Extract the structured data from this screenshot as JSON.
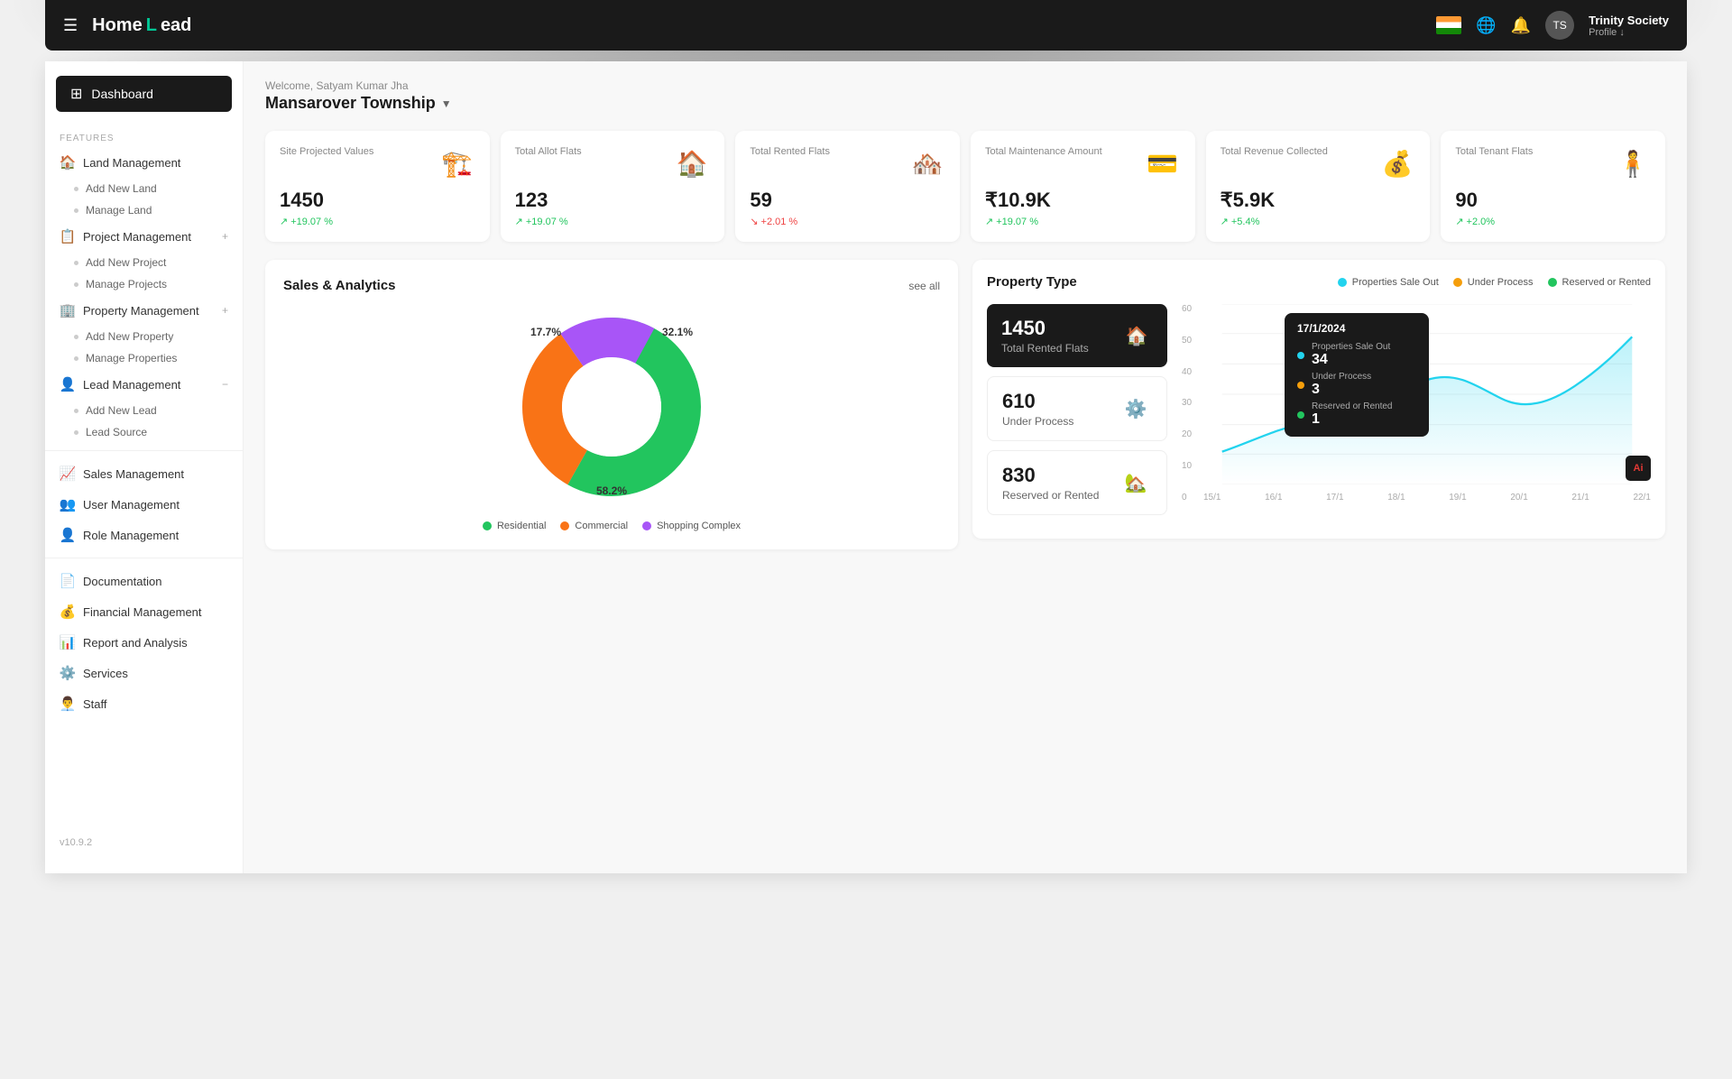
{
  "header": {
    "hamburger_label": "☰",
    "logo_text": "HomeLead",
    "user_name": "Trinity Society",
    "user_role": "Profile ↓",
    "avatar_initials": "TS"
  },
  "sidebar": {
    "dashboard_label": "Dashboard",
    "features_label": "FEATURES",
    "version": "v10.9.2",
    "nav_items": [
      {
        "label": "Land Management",
        "icon": "🏠",
        "expanded": true
      },
      {
        "label": "Add New Land",
        "sub": true
      },
      {
        "label": "Manage Land",
        "sub": true
      },
      {
        "label": "Project Management",
        "icon": "📋",
        "expanded": false
      },
      {
        "label": "Add New Project",
        "sub": true
      },
      {
        "label": "Manage Projects",
        "sub": true
      },
      {
        "label": "Property Management",
        "icon": "🏢",
        "expanded": true
      },
      {
        "label": "Add New Property",
        "sub": true
      },
      {
        "label": "Manage Properties",
        "sub": true
      },
      {
        "label": "Lead Management",
        "icon": "👤",
        "expanded": true
      },
      {
        "label": "Add New Lead",
        "sub": true
      },
      {
        "label": "Lead Source",
        "sub": true
      },
      {
        "label": "Sales Management",
        "icon": "📈"
      },
      {
        "label": "User Management",
        "icon": "👥"
      },
      {
        "label": "Role Management",
        "icon": "👤"
      },
      {
        "label": "Documentation",
        "icon": "📄"
      },
      {
        "label": "Financial Management",
        "icon": "💰"
      },
      {
        "label": "Report and Analysis",
        "icon": "📊"
      },
      {
        "label": "Services",
        "icon": "⚙️"
      },
      {
        "label": "Staff",
        "icon": "👨‍💼"
      }
    ]
  },
  "content": {
    "welcome_text": "Welcome, Satyam Kumar Jha",
    "society_name": "Mansarover Township",
    "stats": [
      {
        "label": "Site Projected Values",
        "value": "1450",
        "change": "+19.07 %",
        "positive": true
      },
      {
        "label": "Total Allot Flats",
        "value": "123",
        "change": "+19.07 %",
        "positive": true
      },
      {
        "label": "Total Rented Flats",
        "value": "59",
        "change": "+2.01 %",
        "positive": false
      },
      {
        "label": "Total Maintenance Amount",
        "value": "₹10.9K",
        "change": "+19.07 %",
        "positive": true
      },
      {
        "label": "Total Revenue Collected",
        "value": "₹5.9K",
        "change": "+5.4%",
        "positive": true
      },
      {
        "label": "Total Tenant Flats",
        "value": "90",
        "change": "+2.0%",
        "positive": true
      }
    ],
    "sales_analytics": {
      "title": "Sales & Analytics",
      "see_all": "see all",
      "segments": [
        {
          "label": "Residential",
          "value": 58.2,
          "color": "#22c55e"
        },
        {
          "label": "Commercial",
          "value": 32.1,
          "color": "#f97316"
        },
        {
          "label": "Shopping Complex",
          "value": 17.7,
          "color": "#a855f7"
        }
      ],
      "labels": [
        "17.7%",
        "32.1%",
        "58.2%"
      ]
    },
    "property_type": {
      "title": "Property Type",
      "legend": [
        {
          "label": "Properties Sale Out",
          "color": "#22d3ee"
        },
        {
          "label": "Under Process",
          "color": "#f59e0b"
        },
        {
          "label": "Reserved or Rented",
          "color": "#22c55e"
        }
      ],
      "cards": [
        {
          "value": "1450",
          "label": "Total Rented Flats",
          "dark": true
        },
        {
          "value": "610",
          "label": "Under Process",
          "dark": false
        },
        {
          "value": "830",
          "label": "Reserved or Rented",
          "dark": false
        }
      ],
      "tooltip": {
        "date": "17/1/2024",
        "rows": [
          {
            "label": "Properties Sale Out",
            "value": "34",
            "color": "#22d3ee"
          },
          {
            "label": "Under Process",
            "value": "3",
            "color": "#f59e0b"
          },
          {
            "label": "Reserved or Rented",
            "value": "1",
            "color": "#22c55e"
          }
        ]
      },
      "x_labels": [
        "15/1",
        "16/1",
        "17/1",
        "18/1",
        "19/1",
        "20/1",
        "21/1",
        "22/1"
      ],
      "y_labels": [
        "0",
        "10",
        "20",
        "30",
        "40",
        "50",
        "60"
      ]
    }
  }
}
